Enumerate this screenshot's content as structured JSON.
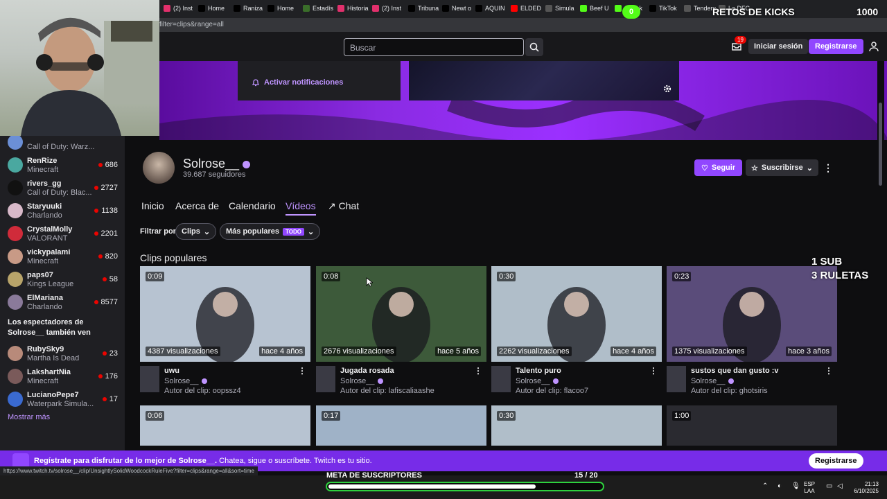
{
  "browser": {
    "tabs": [
      {
        "label": "(2) Inst",
        "color": "#e1306c"
      },
      {
        "label": "Home",
        "color": "#000000"
      },
      {
        "label": "Raniza",
        "color": "#000000"
      },
      {
        "label": "Home",
        "color": "#000000"
      },
      {
        "label": "Estadís",
        "color": "#3a6e2a"
      },
      {
        "label": "Historia",
        "color": "#e1306c"
      },
      {
        "label": "(2) Inst",
        "color": "#e1306c"
      },
      {
        "label": "Tribuna",
        "color": "#000000"
      },
      {
        "label": "Newt o",
        "color": "#000000"
      },
      {
        "label": "AQUIN",
        "color": "#000000"
      },
      {
        "label": "ELDED",
        "color": "#ff0000"
      },
      {
        "label": "Simula",
        "color": "#555555"
      },
      {
        "label": "Beef U",
        "color": "#53fc18"
      },
      {
        "label": "milenk",
        "color": "#53fc18"
      },
      {
        "label": "TikTok",
        "color": "#000000"
      },
      {
        "label": "Tendenc",
        "color": "#555555"
      },
      {
        "label": "La DFC",
        "color": "#555555"
      }
    ],
    "url": "filter=clips&range=all",
    "status_url": "https://www.twitch.tv/solrose__/clip/UnsightlySolidWoodcockRuleFive?filter=clips&range=all&sort=time"
  },
  "header": {
    "search_placeholder": "Buscar",
    "notifications_count": "19",
    "login_label": "Iniciar sesión",
    "signup_label": "Registrarse",
    "accent": "#9147ff"
  },
  "overlay": {
    "retos_title": "RETOS DE KICKS",
    "retos_count": "1000",
    "kick_badge": "0",
    "sub_line1": "1 SUB",
    "sub_line2": "3 RULETAS",
    "meta_label": "META DE SUSCRIPTORES",
    "meta_count": "15",
    "meta_total": "/ 20",
    "meta_progress": 0.75
  },
  "sidebar": {
    "channels": [
      {
        "name": "",
        "game": "Call of Duty: Warz...",
        "viewers": "",
        "color": "#6b8fd6"
      },
      {
        "name": "RenRize",
        "game": "Minecraft",
        "viewers": "686",
        "color": "#4aa8a0"
      },
      {
        "name": "rivers_gg",
        "game": "Call of Duty: Blac...",
        "viewers": "2727",
        "color": "#111111"
      },
      {
        "name": "Staryuuki",
        "game": "Charlando",
        "viewers": "1138",
        "color": "#d8b9c9"
      },
      {
        "name": "CrystalMolly",
        "game": "VALORANT",
        "viewers": "2201",
        "color": "#d02b3a"
      },
      {
        "name": "vickypalami",
        "game": "Minecraft",
        "viewers": "820",
        "color": "#c89a86"
      },
      {
        "name": "paps07",
        "game": "Kings League",
        "viewers": "58",
        "color": "#b8a46a"
      },
      {
        "name": "ElMariana",
        "game": "Charlando",
        "viewers": "8577",
        "color": "#8a7a9a"
      }
    ],
    "also_watch": "Los espectadores de Solrose__ también ven",
    "also_channels": [
      {
        "name": "RubySky9",
        "game": "Martha Is Dead",
        "viewers": "23",
        "color": "#b88a7a"
      },
      {
        "name": "LakshartNia",
        "game": "Minecraft",
        "viewers": "176",
        "color": "#7a5a5a"
      },
      {
        "name": "LucianoPepe7",
        "game": "Waterpark Simula...",
        "viewers": "17",
        "color": "#3a6ad0"
      }
    ],
    "show_more": "Mostrar más"
  },
  "banner": {
    "notify_label": "Activar notificaciones"
  },
  "channel": {
    "name": "Solrose__",
    "followers": "39.687 seguidores",
    "follow_label": "Seguir",
    "subscribe_label": "Suscribirse",
    "nav": [
      "Inicio",
      "Acerca de",
      "Calendario",
      "Vídeos",
      "Chat"
    ],
    "active_tab": "Vídeos"
  },
  "filters": {
    "label": "Filtrar por",
    "type": "Clips",
    "sort": "Más populares",
    "range_tag": "TODO"
  },
  "clips_section": {
    "title": "Clips populares",
    "clips": [
      {
        "duration": "0:09",
        "views": "4387 visualizaciones",
        "age": "hace 4 años",
        "title": "uwu",
        "channel": "Solrose__",
        "author": "Autor del clip: oopssz4",
        "bg": "#b7c3d1"
      },
      {
        "duration": "0:08",
        "views": "2676 visualizaciones",
        "age": "hace 5 años",
        "title": "Jugada rosada",
        "channel": "Solrose__",
        "author": "Autor del clip: lafiscaliaashe",
        "bg": "#3d5a3a"
      },
      {
        "duration": "0:30",
        "views": "2262 visualizaciones",
        "age": "hace 4 años",
        "title": "Talento puro",
        "channel": "Solrose__",
        "author": "Autor del clip: flacoo7",
        "bg": "#b0bec9"
      },
      {
        "duration": "0:23",
        "views": "1375 visualizaciones",
        "age": "hace 3 años",
        "title": "sustos que dan gusto :v",
        "channel": "Solrose__",
        "author": "Autor del clip: ghotsiris",
        "bg": "#5a4c7a"
      }
    ],
    "row2_durations": [
      "0:06",
      "0:17",
      "0:30",
      "1:00"
    ]
  },
  "bottom_banner": {
    "text_bold": "Regístrate para disfrutar de lo mejor de Solrose__.",
    "text_rest": " Chatea, sigue o suscríbete. Twitch es tu sitio.",
    "signup_label": "Registrarse"
  },
  "taskbar": {
    "lang_line1": "ESP",
    "lang_line2": "LAA",
    "time": "21:13",
    "date": "6/10/2025"
  }
}
